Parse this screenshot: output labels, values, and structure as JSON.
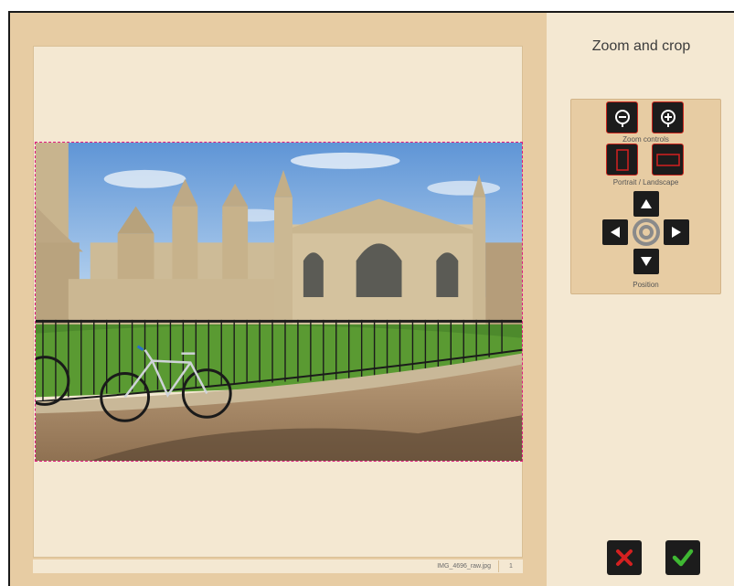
{
  "panel": {
    "title": "Zoom and crop",
    "zoom_label": "Zoom controls",
    "orientation_label": "Portrait / Landscape",
    "position_label": "Position"
  },
  "status": {
    "filename": "IMG_4696_raw.jpg",
    "page": "1"
  },
  "icons": {
    "zoom_out": "zoom-out-icon",
    "zoom_in": "zoom-in-icon",
    "portrait": "portrait-icon",
    "landscape": "landscape-icon",
    "up": "arrow-up-icon",
    "down": "arrow-down-icon",
    "left": "arrow-left-icon",
    "right": "arrow-right-icon",
    "center": "target-icon",
    "cancel": "close-icon",
    "confirm": "checkmark-icon"
  },
  "colors": {
    "frame_bg": "#e7cca3",
    "panel_bg": "#f4e8d2",
    "crop_border": "#e0197f",
    "cancel": "#d42020",
    "confirm": "#3fb833"
  }
}
